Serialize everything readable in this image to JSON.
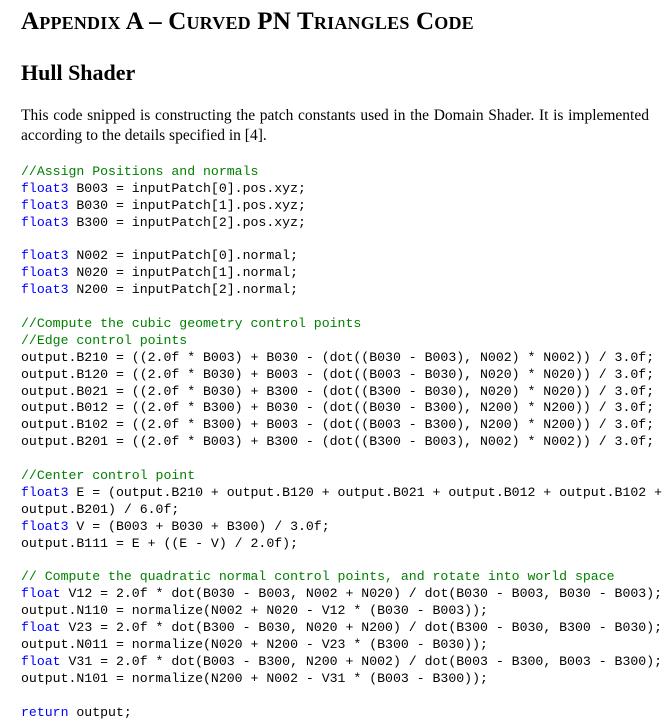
{
  "heading": {
    "prefix_big": "A",
    "prefix_small": "PPENDIX",
    "sep": " A – ",
    "w1_big": "C",
    "w1_small": "URVED",
    "w2": " PN ",
    "w3_big": "T",
    "w3_small": "RIANGLES",
    "w4_big": " C",
    "w4_small": "ODE"
  },
  "subheading": "Hull Shader",
  "paragraph": "This code snipped is constructing the patch constants used in the Domain Shader. It is implemented according to the details specified in [4].",
  "code": {
    "c1": "//Assign Positions and normals",
    "t_float3": "float3",
    "t_float": "float",
    "p1": " B003 = inputPatch[0].pos.xyz;",
    "p2": " B030 = inputPatch[1].pos.xyz;",
    "p3": " B300 = inputPatch[2].pos.xyz;",
    "n1": " N002 = inputPatch[0].normal;",
    "n2": " N020 = inputPatch[1].normal;",
    "n3": " N200 = inputPatch[2].normal;",
    "c2": "//Compute the cubic geometry control points",
    "c3": "//Edge control points",
    "e1": "output.B210 = ((2.0f * B003) + B030 - (dot((B030 - B003), N002) * N002)) / 3.0f;",
    "e2": "output.B120 = ((2.0f * B030) + B003 - (dot((B003 - B030), N020) * N020)) / 3.0f;",
    "e3": "output.B021 = ((2.0f * B030) + B300 - (dot((B300 - B030), N020) * N020)) / 3.0f;",
    "e4": "output.B012 = ((2.0f * B300) + B030 - (dot((B030 - B300), N200) * N200)) / 3.0f;",
    "e5": "output.B102 = ((2.0f * B300) + B003 - (dot((B003 - B300), N200) * N200)) / 3.0f;",
    "e6": "output.B201 = ((2.0f * B003) + B300 - (dot((B300 - B003), N002) * N002)) / 3.0f;",
    "c4": "//Center control point",
    "m1": " E = (output.B210 + output.B120 + output.B021 + output.B012 + output.B102 +",
    "m2": "output.B201) / 6.0f;",
    "m3": " V = (B003 + B030 + B300) / 3.0f;",
    "m4": "output.B111 = E + ((E - V) / 2.0f);",
    "c5": "// Compute the quadratic normal control points, and rotate into world space",
    "q1": " V12 = 2.0f * dot(B030 - B003, N002 + N020) / dot(B030 - B003, B030 - B003);",
    "q2": "output.N110 = normalize(N002 + N020 - V12 * (B030 - B003));",
    "q3": " V23 = 2.0f * dot(B300 - B030, N020 + N200) / dot(B300 - B030, B300 - B030);",
    "q4": "output.N011 = normalize(N020 + N200 - V23 * (B300 - B030));",
    "q5": " V31 = 2.0f * dot(B003 - B300, N200 + N002) / dot(B003 - B300, B003 - B300);",
    "q6": "output.N101 = normalize(N200 + N002 - V31 * (B003 - B300));",
    "t_return": "return",
    "r1": " output;"
  }
}
